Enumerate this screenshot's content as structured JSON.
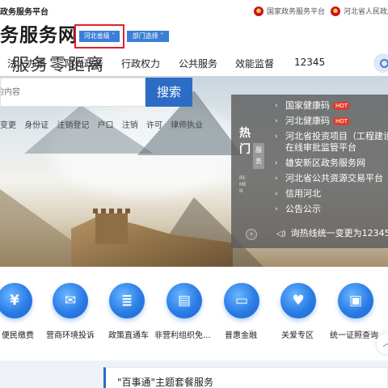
{
  "header": {
    "portal_small": "政务服务平台",
    "portal_big": "务服务网",
    "region_select": "河北省级",
    "dept_select": "部门选择",
    "top_links": [
      "国家政务服务平台",
      "河北省人民政府"
    ]
  },
  "nav": {
    "items": [
      "法人办事",
      "阳光政务",
      "行政权力",
      "公共服务",
      "效能监督",
      "12345"
    ]
  },
  "banner": {
    "slogan": "服务零距离",
    "search_placeholder": "的内容",
    "search_button": "搜索",
    "hot_words": [
      "变更",
      "身份证",
      "注销登记",
      "户口",
      "注销",
      "许可",
      "律师执业"
    ]
  },
  "hot_panel": {
    "title_chars": [
      "热",
      "门"
    ],
    "service_label": "服务",
    "english": "REMEN",
    "items": [
      {
        "label": "国家健康码",
        "badge": "HOT"
      },
      {
        "label": "河北健康码",
        "badge": "HOT"
      },
      {
        "label": "河北省投资项目（工程建设在线审批监管平台"
      },
      {
        "label": "雄安新区政务服务网"
      },
      {
        "label": "河北省公共资源交易平台"
      },
      {
        "label": "信用河北"
      },
      {
        "label": "公告公示"
      }
    ],
    "notice": "询热线统一变更为12345"
  },
  "services": [
    {
      "label": "便民缴费",
      "icon": "payment-icon"
    },
    {
      "label": "营商环境投诉",
      "icon": "complaint-icon"
    },
    {
      "label": "政策直通车",
      "icon": "policy-icon"
    },
    {
      "label": "非营利组织免...",
      "icon": "nonprofit-icon"
    },
    {
      "label": "普惠金融",
      "icon": "finance-icon"
    },
    {
      "label": "关爱专区",
      "icon": "care-icon"
    },
    {
      "label": "统一证照查询",
      "icon": "certificate-icon"
    }
  ],
  "bundle": {
    "title": "\"百事通\"主题套餐服务"
  },
  "colors": {
    "primary": "#2d6cc5",
    "highlight_border": "#e3202a",
    "hot_badge": "#e13b2b"
  }
}
